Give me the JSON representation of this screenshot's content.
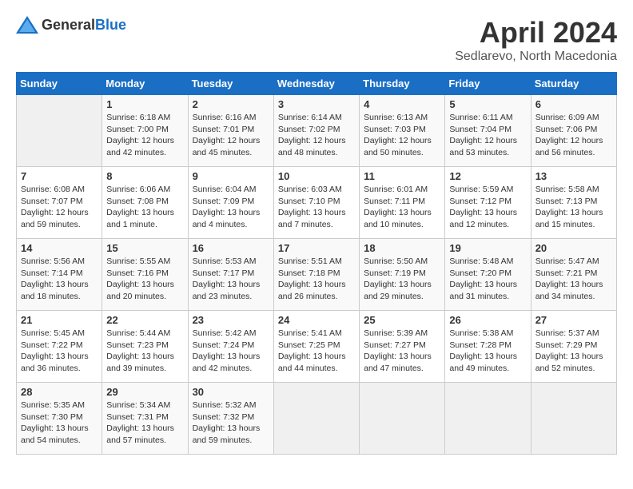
{
  "header": {
    "logo_general": "General",
    "logo_blue": "Blue",
    "month_title": "April 2024",
    "location": "Sedlarevo, North Macedonia"
  },
  "days_of_week": [
    "Sunday",
    "Monday",
    "Tuesday",
    "Wednesday",
    "Thursday",
    "Friday",
    "Saturday"
  ],
  "weeks": [
    [
      {
        "day": "",
        "info": ""
      },
      {
        "day": "1",
        "info": "Sunrise: 6:18 AM\nSunset: 7:00 PM\nDaylight: 12 hours\nand 42 minutes."
      },
      {
        "day": "2",
        "info": "Sunrise: 6:16 AM\nSunset: 7:01 PM\nDaylight: 12 hours\nand 45 minutes."
      },
      {
        "day": "3",
        "info": "Sunrise: 6:14 AM\nSunset: 7:02 PM\nDaylight: 12 hours\nand 48 minutes."
      },
      {
        "day": "4",
        "info": "Sunrise: 6:13 AM\nSunset: 7:03 PM\nDaylight: 12 hours\nand 50 minutes."
      },
      {
        "day": "5",
        "info": "Sunrise: 6:11 AM\nSunset: 7:04 PM\nDaylight: 12 hours\nand 53 minutes."
      },
      {
        "day": "6",
        "info": "Sunrise: 6:09 AM\nSunset: 7:06 PM\nDaylight: 12 hours\nand 56 minutes."
      }
    ],
    [
      {
        "day": "7",
        "info": "Sunrise: 6:08 AM\nSunset: 7:07 PM\nDaylight: 12 hours\nand 59 minutes."
      },
      {
        "day": "8",
        "info": "Sunrise: 6:06 AM\nSunset: 7:08 PM\nDaylight: 13 hours\nand 1 minute."
      },
      {
        "day": "9",
        "info": "Sunrise: 6:04 AM\nSunset: 7:09 PM\nDaylight: 13 hours\nand 4 minutes."
      },
      {
        "day": "10",
        "info": "Sunrise: 6:03 AM\nSunset: 7:10 PM\nDaylight: 13 hours\nand 7 minutes."
      },
      {
        "day": "11",
        "info": "Sunrise: 6:01 AM\nSunset: 7:11 PM\nDaylight: 13 hours\nand 10 minutes."
      },
      {
        "day": "12",
        "info": "Sunrise: 5:59 AM\nSunset: 7:12 PM\nDaylight: 13 hours\nand 12 minutes."
      },
      {
        "day": "13",
        "info": "Sunrise: 5:58 AM\nSunset: 7:13 PM\nDaylight: 13 hours\nand 15 minutes."
      }
    ],
    [
      {
        "day": "14",
        "info": "Sunrise: 5:56 AM\nSunset: 7:14 PM\nDaylight: 13 hours\nand 18 minutes."
      },
      {
        "day": "15",
        "info": "Sunrise: 5:55 AM\nSunset: 7:16 PM\nDaylight: 13 hours\nand 20 minutes."
      },
      {
        "day": "16",
        "info": "Sunrise: 5:53 AM\nSunset: 7:17 PM\nDaylight: 13 hours\nand 23 minutes."
      },
      {
        "day": "17",
        "info": "Sunrise: 5:51 AM\nSunset: 7:18 PM\nDaylight: 13 hours\nand 26 minutes."
      },
      {
        "day": "18",
        "info": "Sunrise: 5:50 AM\nSunset: 7:19 PM\nDaylight: 13 hours\nand 29 minutes."
      },
      {
        "day": "19",
        "info": "Sunrise: 5:48 AM\nSunset: 7:20 PM\nDaylight: 13 hours\nand 31 minutes."
      },
      {
        "day": "20",
        "info": "Sunrise: 5:47 AM\nSunset: 7:21 PM\nDaylight: 13 hours\nand 34 minutes."
      }
    ],
    [
      {
        "day": "21",
        "info": "Sunrise: 5:45 AM\nSunset: 7:22 PM\nDaylight: 13 hours\nand 36 minutes."
      },
      {
        "day": "22",
        "info": "Sunrise: 5:44 AM\nSunset: 7:23 PM\nDaylight: 13 hours\nand 39 minutes."
      },
      {
        "day": "23",
        "info": "Sunrise: 5:42 AM\nSunset: 7:24 PM\nDaylight: 13 hours\nand 42 minutes."
      },
      {
        "day": "24",
        "info": "Sunrise: 5:41 AM\nSunset: 7:25 PM\nDaylight: 13 hours\nand 44 minutes."
      },
      {
        "day": "25",
        "info": "Sunrise: 5:39 AM\nSunset: 7:27 PM\nDaylight: 13 hours\nand 47 minutes."
      },
      {
        "day": "26",
        "info": "Sunrise: 5:38 AM\nSunset: 7:28 PM\nDaylight: 13 hours\nand 49 minutes."
      },
      {
        "day": "27",
        "info": "Sunrise: 5:37 AM\nSunset: 7:29 PM\nDaylight: 13 hours\nand 52 minutes."
      }
    ],
    [
      {
        "day": "28",
        "info": "Sunrise: 5:35 AM\nSunset: 7:30 PM\nDaylight: 13 hours\nand 54 minutes."
      },
      {
        "day": "29",
        "info": "Sunrise: 5:34 AM\nSunset: 7:31 PM\nDaylight: 13 hours\nand 57 minutes."
      },
      {
        "day": "30",
        "info": "Sunrise: 5:32 AM\nSunset: 7:32 PM\nDaylight: 13 hours\nand 59 minutes."
      },
      {
        "day": "",
        "info": ""
      },
      {
        "day": "",
        "info": ""
      },
      {
        "day": "",
        "info": ""
      },
      {
        "day": "",
        "info": ""
      }
    ]
  ]
}
